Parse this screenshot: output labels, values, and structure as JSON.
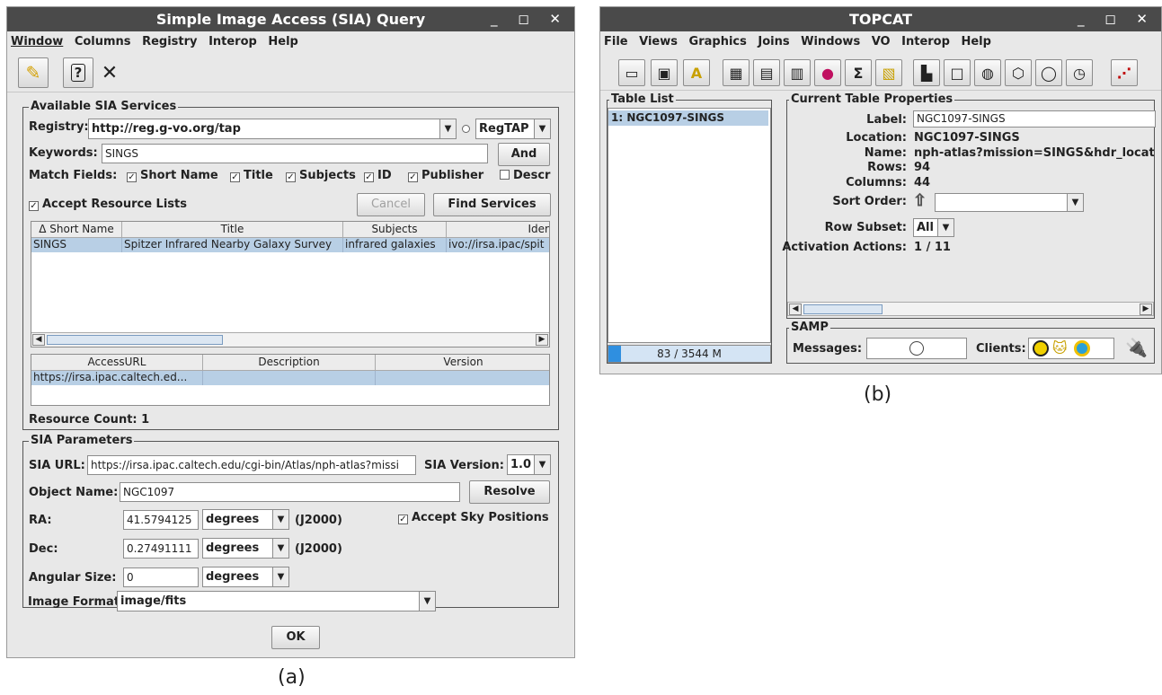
{
  "sia_window": {
    "title": "Simple Image Access (SIA) Query",
    "window_controls": "_ ◻ ✕",
    "menu": [
      "Window",
      "Columns",
      "Registry",
      "Interop",
      "Help"
    ],
    "available_services": {
      "group_title": "Available SIA Services",
      "registry_label": "Registry:",
      "registry_value": "http://reg.g-vo.org/tap",
      "protocol_value": "RegTAP",
      "keywords_label": "Keywords:",
      "keywords_value": "SINGS",
      "and_button": "And",
      "match_fields_label": "Match Fields:",
      "match_fields": [
        {
          "label": "Short Name",
          "checked": true
        },
        {
          "label": "Title",
          "checked": true
        },
        {
          "label": "Subjects",
          "checked": true
        },
        {
          "label": "ID",
          "checked": true
        },
        {
          "label": "Publisher",
          "checked": true
        },
        {
          "label": "Descr",
          "checked": false
        }
      ],
      "accept_resource_lists": "Accept Resource Lists",
      "cancel_button": "Cancel",
      "find_services_button": "Find Services",
      "services_table": {
        "columns": [
          "Δ Short Name",
          "Title",
          "Subjects",
          "Ider"
        ],
        "rows": [
          [
            "SINGS",
            "Spitzer Infrared Nearby Galaxy Survey",
            "infrared galaxies",
            "ivo://irsa.ipac/spit"
          ]
        ]
      },
      "access_table": {
        "columns": [
          "AccessURL",
          "Description",
          "Version"
        ],
        "rows": [
          [
            "https://irsa.ipac.caltech.ed...",
            "",
            ""
          ]
        ]
      },
      "resource_count": "Resource Count: 1"
    },
    "sia_parameters": {
      "group_title": "SIA Parameters",
      "sia_url_label": "SIA URL:",
      "sia_url_value": "https://irsa.ipac.caltech.edu/cgi-bin/Atlas/nph-atlas?missi",
      "sia_version_label": "SIA Version:",
      "sia_version_value": "1.0",
      "object_name_label": "Object Name:",
      "object_name_value": "NGC1097",
      "resolve_button": "Resolve",
      "ra_label": "RA:",
      "ra_value": "41.5794125",
      "ra_unit": "degrees",
      "ra_epoch": "(J2000)",
      "accept_sky_positions": "Accept Sky Positions",
      "dec_label": "Dec:",
      "dec_value": "0.27491111",
      "dec_unit": "degrees",
      "dec_epoch": "(J2000)",
      "angular_size_label": "Angular Size:",
      "angular_size_value": "0",
      "angular_size_unit": "degrees",
      "image_format_label": "Image Format:",
      "image_format_value": "image/fits"
    },
    "ok_button": "OK",
    "caption": "(a)"
  },
  "topcat_window": {
    "title": "TOPCAT",
    "window_controls": "_ ◻ ✕",
    "menu": [
      "File",
      "Views",
      "Graphics",
      "Joins",
      "Windows",
      "VO",
      "Interop",
      "Help"
    ],
    "table_list_title": "Table List",
    "table_list_items": [
      "1: NGC1097-SINGS"
    ],
    "memory": "83 / 3544 M",
    "current_props_title": "Current Table Properties",
    "props": {
      "label_label": "Label:",
      "label_value": "NGC1097-SINGS",
      "location_label": "Location:",
      "location_value": "NGC1097-SINGS",
      "name_label": "Name:",
      "name_value": "nph-atlas?mission=SINGS&hdr_locati",
      "rows_label": "Rows:",
      "rows_value": "94",
      "columns_label": "Columns:",
      "columns_value": "44",
      "sort_order_label": "Sort Order:",
      "row_subset_label": "Row Subset:",
      "row_subset_value": "All",
      "activation_label": "Activation Actions:",
      "activation_value": "1 / 11"
    },
    "samp_title": "SAMP",
    "messages_label": "Messages:",
    "clients_label": "Clients:",
    "caption": "(b)"
  }
}
